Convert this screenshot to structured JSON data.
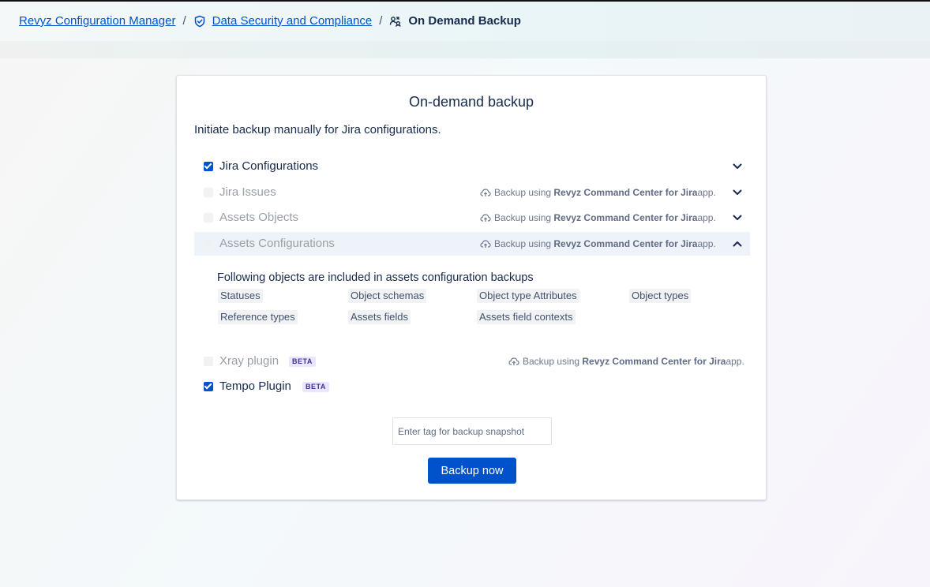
{
  "breadcrumb": {
    "root": "Revyz Configuration Manager",
    "section": "Data Security and Compliance",
    "current": "On Demand Backup",
    "separator": "/"
  },
  "card": {
    "title": "On-demand backup",
    "description": "Initiate backup manually for Jira configurations."
  },
  "note": {
    "prefix": "Backup using",
    "app_name": "Revyz Command Center for Jira",
    "suffix": "app."
  },
  "items": [
    {
      "label": "Jira Configurations",
      "checked": true,
      "disabled": false,
      "expanded": false
    },
    {
      "label": "Jira Issues",
      "checked": false,
      "disabled": true,
      "expanded": false
    },
    {
      "label": "Assets Objects",
      "checked": false,
      "disabled": true,
      "expanded": false
    },
    {
      "label": "Assets Configurations",
      "checked": false,
      "disabled": true,
      "expanded": true
    },
    {
      "label": "Xray plugin",
      "checked": false,
      "disabled": true,
      "badge": "BETA"
    },
    {
      "label": "Tempo Plugin",
      "checked": true,
      "disabled": false,
      "badge": "BETA"
    }
  ],
  "assets_config": {
    "title": "Following objects are included in assets configuration backups",
    "objects": [
      "Statuses",
      "Object schemas",
      "Object type Attributes",
      "Object types",
      "Reference types",
      "Assets fields",
      "Assets field contexts"
    ]
  },
  "tag_input": {
    "placeholder": "Enter tag for backup snapshot",
    "value": ""
  },
  "backup_button": "Backup now",
  "icons": {
    "breadcrumb_section": "shield-check-icon",
    "breadcrumb_current": "backup-users-icon",
    "note": "cloud-upload-icon",
    "expand": "chevron-down-icon",
    "collapse": "chevron-up-icon"
  },
  "colors": {
    "accent": "#0052cc",
    "beta_bg": "#eae6ff",
    "beta_text": "#403294",
    "highlight_row": "#eef2f9"
  }
}
